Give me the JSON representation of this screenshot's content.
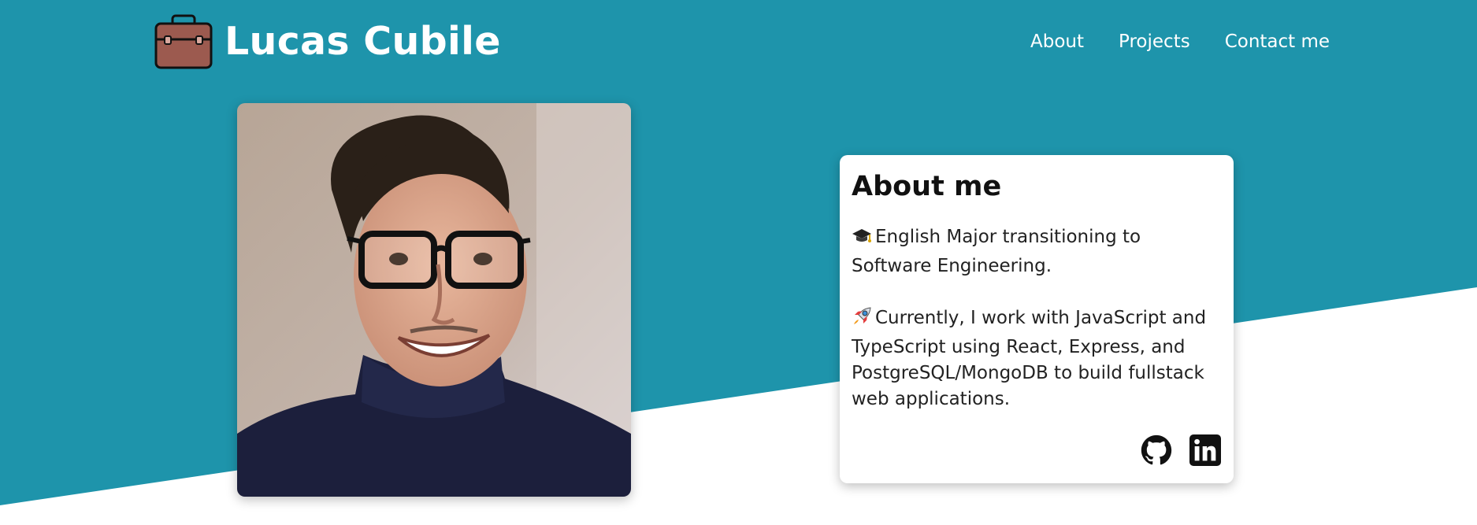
{
  "header": {
    "brand_name": "Lucas Cubile",
    "brand_icon": "briefcase-icon",
    "nav": [
      {
        "label": "About"
      },
      {
        "label": "Projects"
      },
      {
        "label": "Contact me"
      }
    ]
  },
  "profile_photo": {
    "subject": "portrait photo of Lucas Cubile"
  },
  "about": {
    "title": "About me",
    "paragraphs": [
      {
        "icon": "graduation-cap-icon",
        "text": "English Major transitioning to Software Engineering."
      },
      {
        "icon": "rocket-icon",
        "text": "Currently, I work with JavaScript and TypeScript using React, Express, and PostgreSQL/MongoDB to build fullstack web applications."
      }
    ],
    "socials": [
      {
        "icon": "github-icon"
      },
      {
        "icon": "linkedin-icon"
      }
    ]
  },
  "colors": {
    "teal": "#1e94ab",
    "white": "#ffffff",
    "briefcase": "#9c5a4f"
  }
}
